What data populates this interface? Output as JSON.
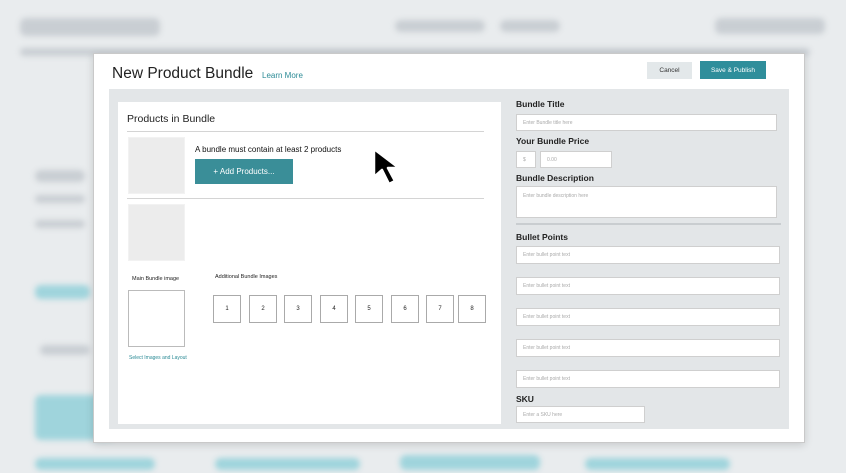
{
  "dialog": {
    "title": "New Product Bundle",
    "learn_more": "Learn More",
    "cancel_label": "Cancel",
    "publish_label": "Save & Publish"
  },
  "products": {
    "heading": "Products in Bundle",
    "message": "A bundle must contain at least 2 products",
    "add_label": "+ Add Products..."
  },
  "images": {
    "main_label": "Main Bundle image",
    "additional_label": "Additional Bundle Images",
    "slots": [
      "1",
      "2",
      "3",
      "4",
      "5",
      "6",
      "7",
      "8"
    ],
    "select_link": "Select Images and Layout"
  },
  "form": {
    "bundle_title_label": "Bundle Title",
    "bundle_title_placeholder": "Enter Bundle title here",
    "price_label": "Your Bundle Price",
    "currency": "$",
    "price_placeholder": "0.00",
    "description_label": "Bundle Description",
    "description_placeholder": "Enter bundle description here",
    "bullets_label": "Bullet Points",
    "bullet_placeholder": "Enter bullet point text",
    "sku_label": "SKU",
    "sku_placeholder": "Enter a SKU here"
  },
  "icons": {
    "cursor": "arrow-cursor-icon"
  },
  "colors": {
    "accent": "#2f8e9b",
    "link": "#2c8b96"
  }
}
